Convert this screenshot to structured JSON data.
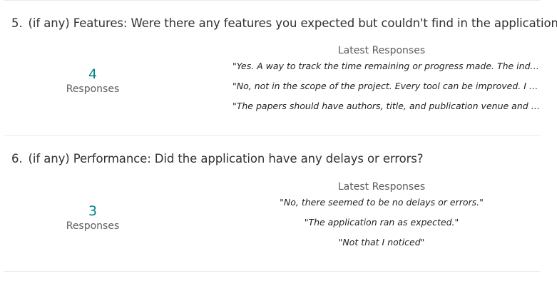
{
  "questions": [
    {
      "number": "5.",
      "title": "(if any) Features: Were there any features you expected but couldn't find in the application?",
      "response_count": "4",
      "responses_label": "Responses",
      "latest_heading": "Latest Responses",
      "latest": [
        "\"Yes. A way to track the time remaining or progress made. The individ...",
        "\"No, not in the scope of the project. Every tool can be improved. I was ...",
        "\"The papers should have authors, title, and publication venue and dat..."
      ]
    },
    {
      "number": "6.",
      "title": "(if any) Performance: Did the application have any delays or errors?",
      "response_count": "3",
      "responses_label": "Responses",
      "latest_heading": "Latest Responses",
      "latest": [
        "\"No, there seemed to be no delays or errors.\"",
        "\"The application ran as expected.\"",
        "\"Not that I noticed\""
      ]
    }
  ]
}
